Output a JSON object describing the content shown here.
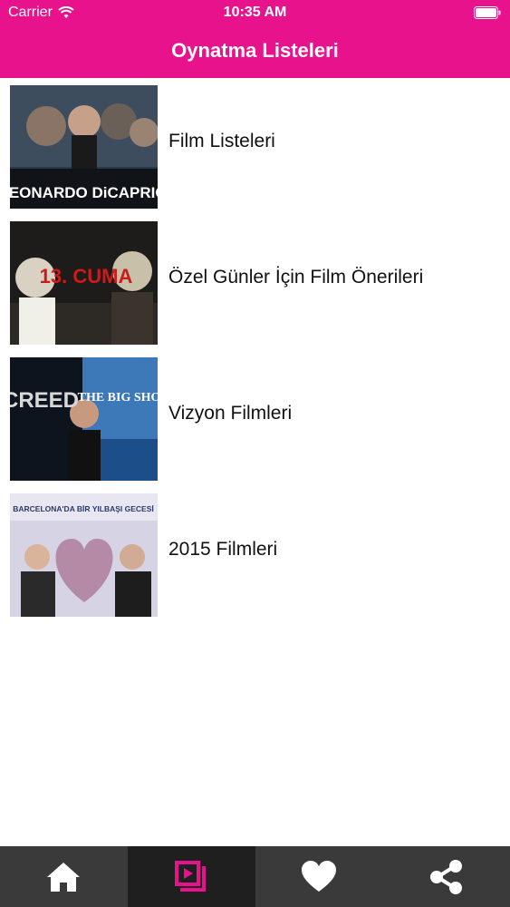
{
  "status_bar": {
    "carrier": "Carrier",
    "time": "10:35 AM"
  },
  "header": {
    "title": "Oynatma Listeleri"
  },
  "playlists": [
    {
      "label": "Film Listeleri",
      "thumb_text": "LEONARDO DiCAPRIO"
    },
    {
      "label": "Özel Günler İçin Film Önerileri",
      "thumb_text": "13. CUMA"
    },
    {
      "label": "Vizyon Filmleri",
      "thumb_text": "CREED",
      "thumb_text_2": "THE BIG SHORT"
    },
    {
      "label": "2015 Filmleri",
      "thumb_text": "BARCELONA'DA BİR YILBAŞI GECESİ"
    }
  ],
  "tabbar": {
    "tabs": [
      "home",
      "playlists",
      "favorites",
      "share"
    ],
    "active": "playlists"
  },
  "colors": {
    "accent": "#e8128c",
    "tabbar": "#3a3a3a",
    "tab_active": "#1f1f1f"
  }
}
